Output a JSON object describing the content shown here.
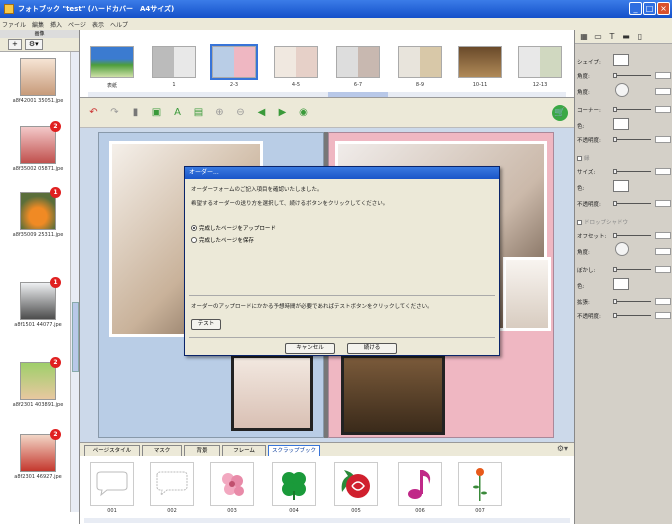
{
  "window": {
    "title": "フォトブック \"test\" (ハードカバー　A4サイズ)"
  },
  "menu": [
    "ファイル",
    "編集",
    "挿入",
    "ページ",
    "表示",
    "ヘルプ"
  ],
  "left_panel": {
    "header": "画像",
    "add_label": "+",
    "gear_label": "⚙▾",
    "items": [
      {
        "file": "a8f42001 35051.jpe",
        "badge": ""
      },
      {
        "file": "a8f35002 05871.jpe",
        "badge": "2"
      },
      {
        "file": "a8f35009 25311.jpe",
        "badge": "1"
      },
      {
        "file": "a8f1501 44077.jpe",
        "badge": "1"
      },
      {
        "file": "a8f2301 403891.jpe",
        "badge": "2"
      },
      {
        "file": "a8f2301 46927.jpe",
        "badge": "2"
      }
    ]
  },
  "page_strip": {
    "labels": [
      "表紙",
      "1",
      "2-3",
      "4-5",
      "6-7",
      "8-9",
      "10-11",
      "12-13"
    ]
  },
  "dialog": {
    "title": "オーダー...",
    "line1": "オーダーフォームのご記入項目を確認いたしました。",
    "line2": "希望するオーダーの送り方を選択して、続けるボタンをクリックしてください。",
    "option1": "完成したページをアップロード",
    "option2": "完成したページを保存",
    "line3": "オーダーのアップロードにかかる予想時間が必要であればテストボタンをクリックしてください。",
    "test_button": "テスト",
    "cancel_button": "キャンセル",
    "continue_button": "続ける"
  },
  "bottom_tabs": [
    "ページスタイル",
    "マスク",
    "背景",
    "フレーム",
    "スクラップブック"
  ],
  "stickers": [
    "001",
    "002",
    "003",
    "004",
    "005",
    "006",
    "007"
  ],
  "right_panel": {
    "shape_label": "シェイプ:",
    "angle_label": "角度:",
    "angle2_label": "角度:",
    "corner_label": "コーナー:",
    "color_label": "色:",
    "opacity_label": "不透明度:",
    "border_section": "縁",
    "size_label": "サイズ:",
    "color2_label": "色:",
    "opacity2_label": "不透明度:",
    "shadow_section": "ドロップシャドウ",
    "offset_label": "オフセット:",
    "angle3_label": "角度:",
    "blur_label": "ぼかし:",
    "color3_label": "色:",
    "spread_label": "拡張:",
    "opacity3_label": "不透明度:"
  }
}
